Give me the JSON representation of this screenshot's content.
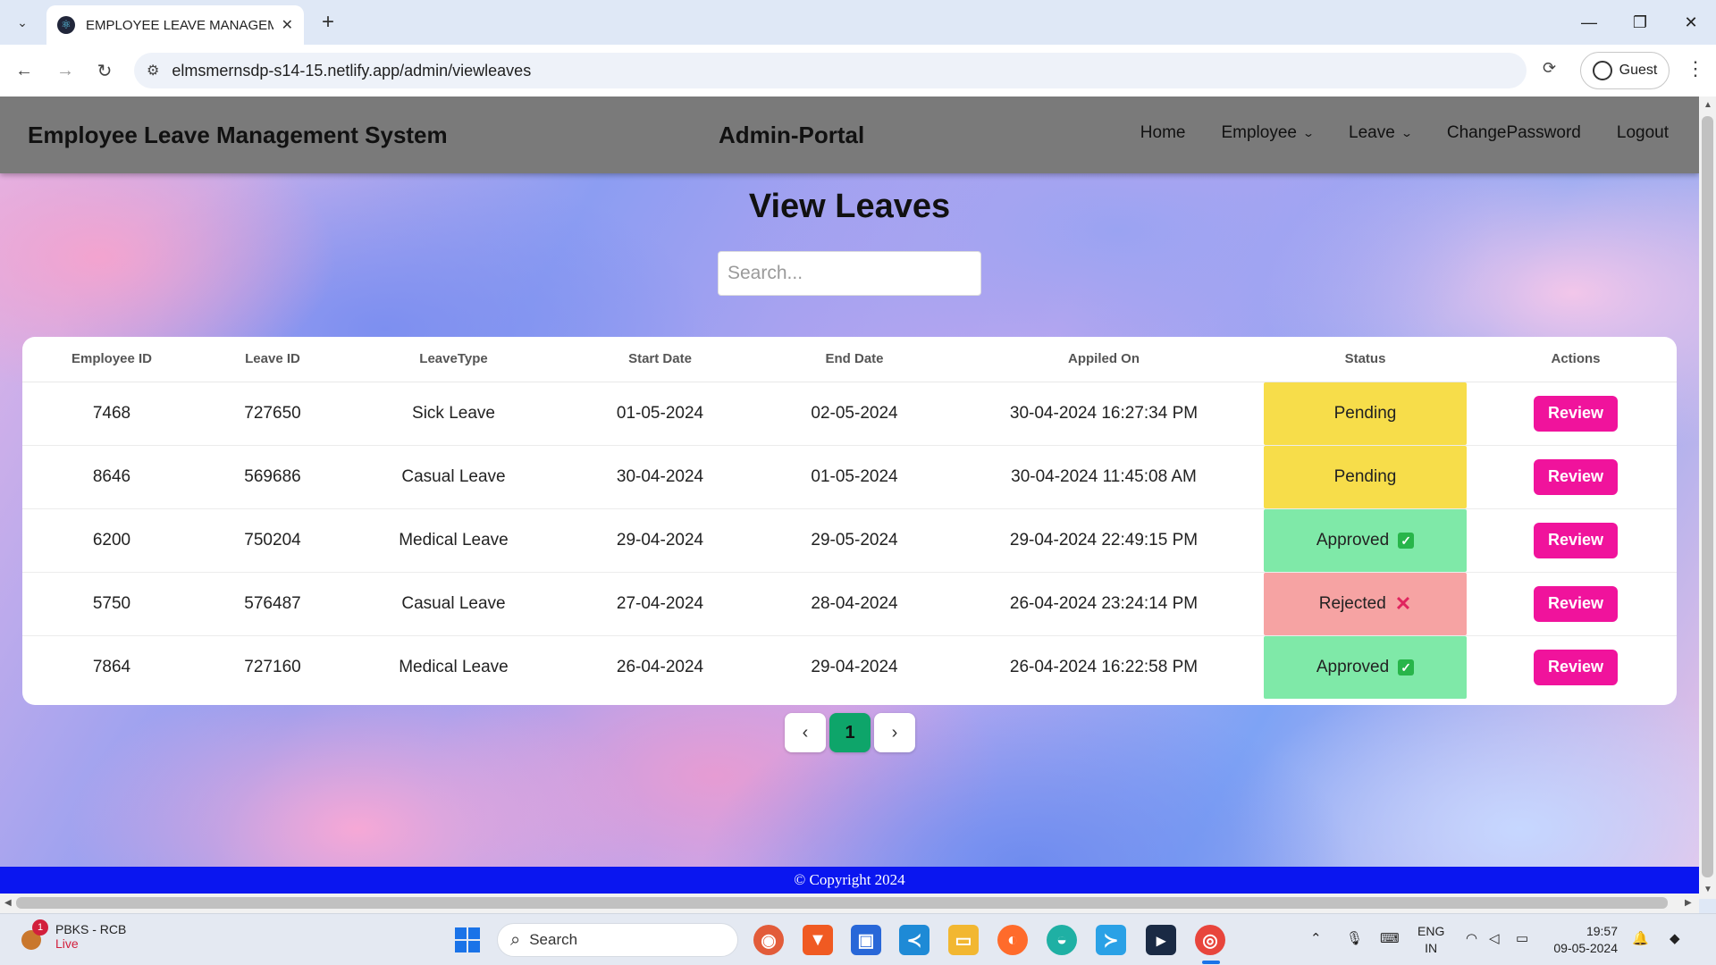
{
  "browser": {
    "tab_title": "EMPLOYEE LEAVE MANAGEMENT",
    "url": "elmsmernsdp-s14-15.netlify.app/admin/viewleaves",
    "profile_label": "Guest"
  },
  "nav": {
    "brand": "Employee Leave Management System",
    "portal": "Admin-Portal",
    "links": {
      "home": "Home",
      "employee": "Employee",
      "leave": "Leave",
      "change_password": "ChangePassword",
      "logout": "Logout"
    }
  },
  "page": {
    "title": "View Leaves",
    "search_placeholder": "Search..."
  },
  "table": {
    "headers": [
      "Employee ID",
      "Leave ID",
      "LeaveType",
      "Start Date",
      "End Date",
      "Appiled On",
      "Status",
      "Actions"
    ],
    "rows": [
      {
        "employee_id": "7468",
        "leave_id": "727650",
        "leave_type": "Sick Leave",
        "start_date": "01-05-2024",
        "end_date": "02-05-2024",
        "applied_on": "30-04-2024 16:27:34 PM",
        "status": "Pending",
        "action": "Review"
      },
      {
        "employee_id": "8646",
        "leave_id": "569686",
        "leave_type": "Casual Leave",
        "start_date": "30-04-2024",
        "end_date": "01-05-2024",
        "applied_on": "30-04-2024 11:45:08 AM",
        "status": "Pending",
        "action": "Review"
      },
      {
        "employee_id": "6200",
        "leave_id": "750204",
        "leave_type": "Medical Leave",
        "start_date": "29-04-2024",
        "end_date": "29-05-2024",
        "applied_on": "29-04-2024 22:49:15 PM",
        "status": "Approved",
        "action": "Review"
      },
      {
        "employee_id": "5750",
        "leave_id": "576487",
        "leave_type": "Casual Leave",
        "start_date": "27-04-2024",
        "end_date": "28-04-2024",
        "applied_on": "26-04-2024 23:24:14 PM",
        "status": "Rejected",
        "action": "Review"
      },
      {
        "employee_id": "7864",
        "leave_id": "727160",
        "leave_type": "Medical Leave",
        "start_date": "26-04-2024",
        "end_date": "29-04-2024",
        "applied_on": "26-04-2024 16:22:58 PM",
        "status": "Approved",
        "action": "Review"
      }
    ]
  },
  "pagination": {
    "prev": "‹",
    "current": "1",
    "next": "›"
  },
  "footer": {
    "text": "© Copyright 2024"
  },
  "colors": {
    "pending": "#f7dd4a",
    "approved": "#7fe9a8",
    "rejected": "#f6a3a3",
    "review_button": "#f0139c",
    "footer": "#0a16f0",
    "active_page": "#0ea56a"
  },
  "taskbar": {
    "news_title": "PBKS - RCB",
    "news_sub": "Live",
    "news_badge": "1",
    "search_label": "Search",
    "lang_top": "ENG",
    "lang_bottom": "IN",
    "time": "19:57",
    "date": "09-05-2024"
  }
}
